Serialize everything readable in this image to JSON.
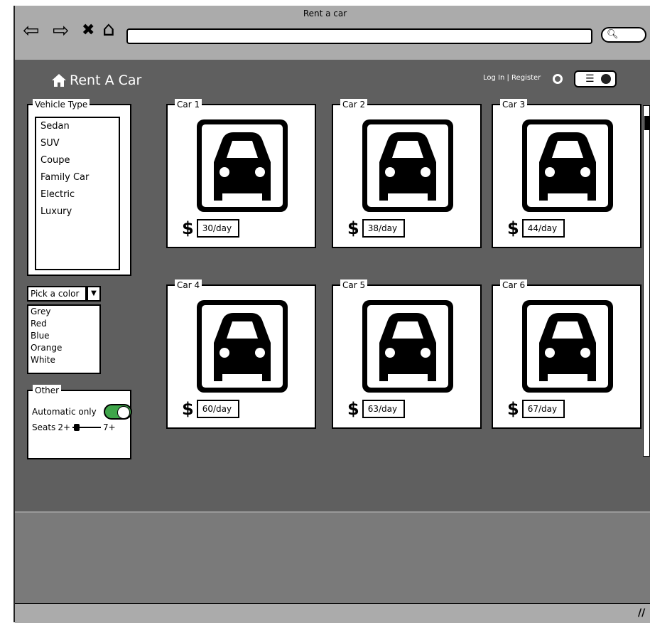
{
  "window": {
    "title": "Rent a car"
  },
  "toolbar": {
    "back_icon": "⇦",
    "forward_icon": "⇨",
    "stop_icon": "✖",
    "home_icon": "⌂",
    "url": "",
    "search_icon": "search-icon"
  },
  "header": {
    "brand": "Rent A Car",
    "login_register": "Log In | Register"
  },
  "filters": {
    "vehicle_type": {
      "legend": "Vehicle Type",
      "items": [
        "Sedan",
        "SUV",
        "Coupe",
        "Family Car",
        "Electric",
        "Luxury"
      ]
    },
    "color": {
      "selected": "Pick a color",
      "options": [
        "Grey",
        "Red",
        "Blue",
        "Orange",
        "White"
      ]
    },
    "other": {
      "legend": "Other",
      "automatic_label": "Automatic only",
      "automatic_on": true,
      "seats_label": "Seats",
      "seats_min": "2+",
      "seats_max": "7+"
    }
  },
  "cars": [
    {
      "name": "Car 1",
      "price": "30/day"
    },
    {
      "name": "Car 2",
      "price": "38/day"
    },
    {
      "name": "Car 3",
      "price": "44/day"
    },
    {
      "name": "Car 4",
      "price": "60/day"
    },
    {
      "name": "Car 5",
      "price": "63/day"
    },
    {
      "name": "Car 6",
      "price": "67/day"
    }
  ],
  "currency_symbol": "$",
  "colors": {
    "toggle_on": "#3fa54a",
    "content_bg": "#5f5f5f",
    "chrome_bg": "#ababab"
  }
}
